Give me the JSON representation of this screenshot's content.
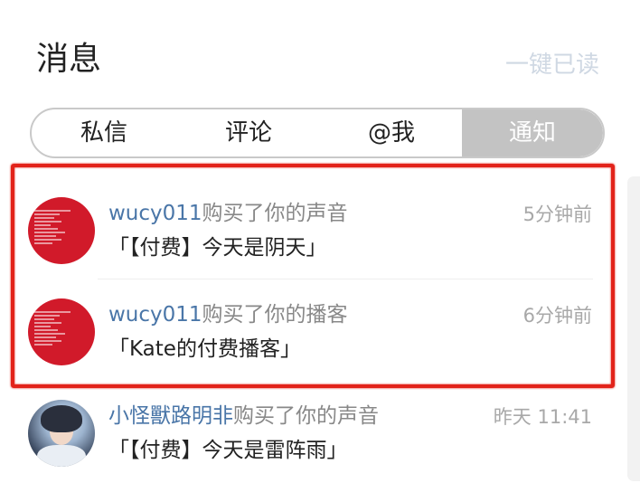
{
  "header": {
    "title": "消息",
    "mark_all_read": "一键已读"
  },
  "tabs": [
    {
      "label": "私信"
    },
    {
      "label": "评论"
    },
    {
      "label": "@我"
    },
    {
      "label": "通知",
      "active": true
    }
  ],
  "notifications": [
    {
      "user": "wucy011",
      "action": "购买了你的声音",
      "time": "5分钟前",
      "content": "「【付费】今天是阴天」",
      "avatar": "red-text-avatar"
    },
    {
      "user": "wucy011",
      "action": "购买了你的播客",
      "time": "6分钟前",
      "content": "「Kate的付费播客」",
      "avatar": "red-text-avatar"
    },
    {
      "user": "小怪獸路明非",
      "action": "购买了你的声音",
      "time": "昨天 11:41",
      "content": "「【付费】今天是雷阵雨」",
      "avatar": "anime-character-avatar"
    }
  ],
  "colors": {
    "accent_highlight": "#e2231a",
    "username": "#4a76a8",
    "tab_active_bg": "#c3c3c3"
  }
}
